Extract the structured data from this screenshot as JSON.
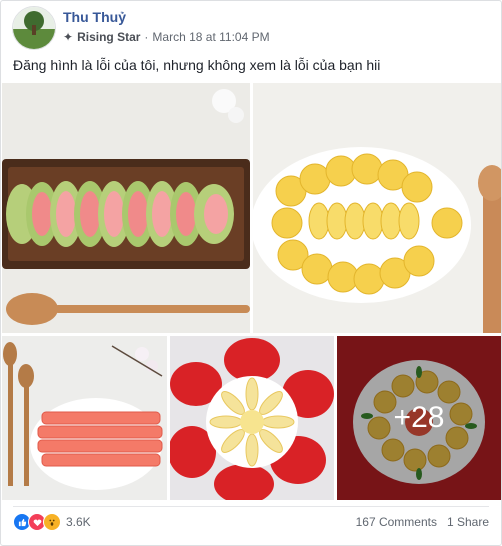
{
  "post": {
    "author": "Thu Thuỷ",
    "badge": "Rising Star",
    "separator": "·",
    "timestamp": "March 18 at 11:04 PM",
    "caption": "Đăng hình là lỗi của tôi, nhưng không xem là lỗi của bạn hii"
  },
  "photos": {
    "more_count": "+28"
  },
  "footer": {
    "reaction_count": "3.6K",
    "comments": "167 Comments",
    "shares": "1 Share",
    "reaction_icons": [
      "like-icon",
      "love-icon",
      "wow-icon"
    ],
    "colors": {
      "like": "#1877f2",
      "love": "#f33e58",
      "wow": "#f7b125"
    }
  },
  "colors": {
    "author": "#385898",
    "meta": "#616770",
    "text": "#1d2129"
  }
}
